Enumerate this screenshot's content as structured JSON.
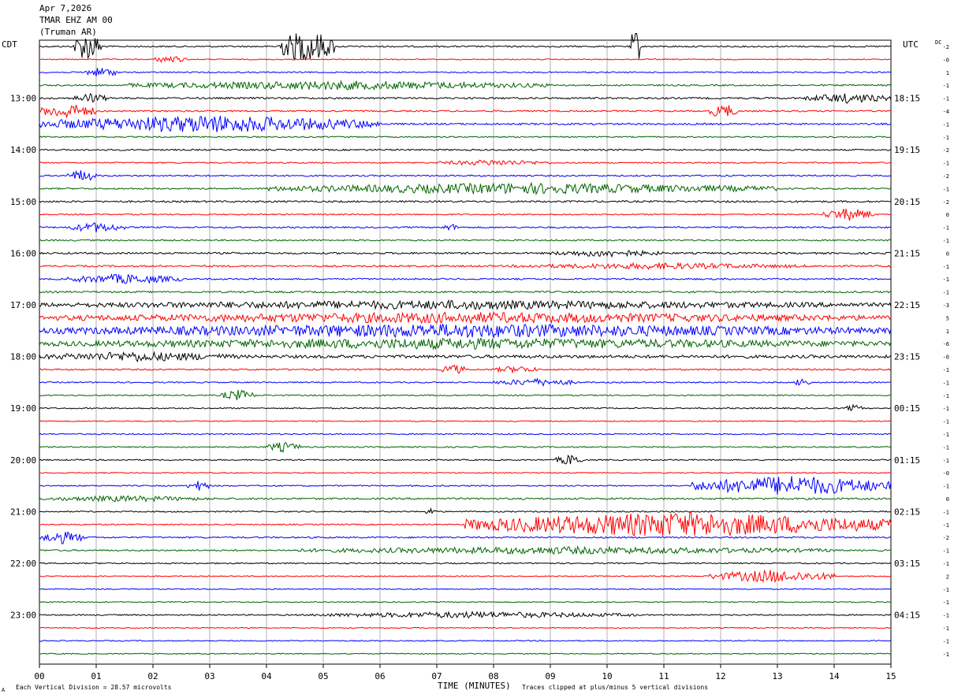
{
  "header": {
    "date": "Apr 7,2026",
    "station": "TMAR EHZ AM 00",
    "location": "(Truman AR)"
  },
  "left_zone_label": "CDT",
  "right_zone_label": "UTC",
  "dc_label": "DC",
  "footer": {
    "scale_note": "Each Vertical Division =  28.57 microvolts",
    "clip_note": "Traces clipped at plus/minus 5 vertical divisions",
    "corner_mark": "A"
  },
  "chart_data": {
    "type": "helicorder",
    "xlabel": "TIME (MINUTES)",
    "x_ticks": [
      "00",
      "01",
      "02",
      "03",
      "04",
      "05",
      "06",
      "07",
      "08",
      "09",
      "10",
      "11",
      "12",
      "13",
      "14",
      "15"
    ],
    "xlim": [
      0,
      15
    ],
    "trace_count": 48,
    "trace_minutes": 15,
    "trace_colors": [
      "#000000",
      "#ff0000",
      "#0000ff",
      "#006400"
    ],
    "left_hour_labels": [
      {
        "label": "13:00",
        "trace": 4
      },
      {
        "label": "14:00",
        "trace": 8
      },
      {
        "label": "15:00",
        "trace": 12
      },
      {
        "label": "16:00",
        "trace": 16
      },
      {
        "label": "17:00",
        "trace": 20
      },
      {
        "label": "18:00",
        "trace": 24
      },
      {
        "label": "19:00",
        "trace": 28
      },
      {
        "label": "20:00",
        "trace": 32
      },
      {
        "label": "21:00",
        "trace": 36
      },
      {
        "label": "22:00",
        "trace": 40
      },
      {
        "label": "23:00",
        "trace": 44
      }
    ],
    "right_hour_labels": [
      {
        "label": "18:15",
        "trace": 4
      },
      {
        "label": "19:15",
        "trace": 8
      },
      {
        "label": "20:15",
        "trace": 12
      },
      {
        "label": "21:15",
        "trace": 16
      },
      {
        "label": "22:15",
        "trace": 20
      },
      {
        "label": "23:15",
        "trace": 24
      },
      {
        "label": "00:15",
        "trace": 28
      },
      {
        "label": "01:15",
        "trace": 32
      },
      {
        "label": "02:15",
        "trace": 36
      },
      {
        "label": "03:15",
        "trace": 40
      },
      {
        "label": "04:15",
        "trace": 44
      }
    ],
    "dc_offsets": [
      "-2",
      "-0",
      "1",
      "-1",
      "-1",
      "-4",
      "-1",
      "-1",
      "-2",
      "-1",
      "-2",
      "-1",
      "-2",
      "0",
      "-1",
      "-1",
      "0",
      "-1",
      "-1",
      "-1",
      "-3",
      "5",
      "1",
      "-6",
      "-0",
      "-1",
      "-1",
      "-1",
      "-1",
      "-1",
      "-1",
      "-1",
      "-1",
      "-0",
      "-1",
      "0",
      "-1",
      "-1",
      "-2",
      "-1",
      "-1",
      "2",
      "-1",
      "-1",
      "-1",
      "-1",
      "-1",
      "-1"
    ],
    "trace_background_amplitude": [
      0.6,
      0.4,
      0.5,
      0.6,
      0.7,
      0.6,
      0.7,
      0.5,
      0.6,
      0.5,
      0.6,
      0.6,
      0.7,
      0.5,
      0.6,
      0.6,
      0.7,
      0.7,
      0.6,
      0.7,
      1.5,
      1.5,
      1.5,
      1.5,
      1.2,
      0.6,
      0.5,
      0.5,
      0.5,
      0.4,
      0.5,
      0.5,
      0.5,
      0.4,
      0.5,
      0.7,
      0.5,
      0.5,
      0.6,
      0.6,
      0.5,
      0.4,
      0.4,
      0.4,
      0.5,
      0.4,
      0.4,
      0.4
    ],
    "events": [
      {
        "trace": 0,
        "start_min": 0.6,
        "end_min": 1.1,
        "amplitude": 6
      },
      {
        "trace": 0,
        "start_min": 4.2,
        "end_min": 5.2,
        "amplitude": 7
      },
      {
        "trace": 0,
        "start_min": 10.4,
        "end_min": 10.6,
        "amplitude": 8
      },
      {
        "trace": 1,
        "start_min": 2.0,
        "end_min": 2.6,
        "amplitude": 1.5
      },
      {
        "trace": 2,
        "start_min": 0.8,
        "end_min": 1.4,
        "amplitude": 2
      },
      {
        "trace": 3,
        "start_min": 1.5,
        "end_min": 9.0,
        "amplitude": 1.8
      },
      {
        "trace": 4,
        "start_min": 0.6,
        "end_min": 1.2,
        "amplitude": 2
      },
      {
        "trace": 4,
        "start_min": 13.5,
        "end_min": 15.0,
        "amplitude": 2
      },
      {
        "trace": 5,
        "start_min": 0.0,
        "end_min": 1.0,
        "amplitude": 3
      },
      {
        "trace": 5,
        "start_min": 11.8,
        "end_min": 12.3,
        "amplitude": 3
      },
      {
        "trace": 6,
        "start_min": 0.0,
        "end_min": 6.0,
        "amplitude": 3.5
      },
      {
        "trace": 9,
        "start_min": 7.0,
        "end_min": 9.0,
        "amplitude": 1.2
      },
      {
        "trace": 10,
        "start_min": 0.5,
        "end_min": 1.0,
        "amplitude": 2.5
      },
      {
        "trace": 11,
        "start_min": 4.0,
        "end_min": 13.0,
        "amplitude": 2.2
      },
      {
        "trace": 13,
        "start_min": 13.8,
        "end_min": 14.7,
        "amplitude": 2.5
      },
      {
        "trace": 14,
        "start_min": 0.5,
        "end_min": 1.5,
        "amplitude": 2
      },
      {
        "trace": 14,
        "start_min": 7.1,
        "end_min": 7.4,
        "amplitude": 1.5
      },
      {
        "trace": 16,
        "start_min": 9.0,
        "end_min": 11.0,
        "amplitude": 1.5
      },
      {
        "trace": 17,
        "start_min": 8.3,
        "end_min": 13.5,
        "amplitude": 1.3
      },
      {
        "trace": 18,
        "start_min": 0.5,
        "end_min": 2.5,
        "amplitude": 2
      },
      {
        "trace": 20,
        "start_min": 0.0,
        "end_min": 15.0,
        "amplitude": 1.8
      },
      {
        "trace": 21,
        "start_min": 0.0,
        "end_min": 15.0,
        "amplitude": 2.2
      },
      {
        "trace": 22,
        "start_min": 0.0,
        "end_min": 15.0,
        "amplitude": 2.8
      },
      {
        "trace": 23,
        "start_min": 0.0,
        "end_min": 15.0,
        "amplitude": 2.2
      },
      {
        "trace": 24,
        "start_min": 0.0,
        "end_min": 3.5,
        "amplitude": 2
      },
      {
        "trace": 25,
        "start_min": 7.1,
        "end_min": 7.5,
        "amplitude": 2.2
      },
      {
        "trace": 25,
        "start_min": 8.0,
        "end_min": 8.8,
        "amplitude": 1.5
      },
      {
        "trace": 26,
        "start_min": 8.0,
        "end_min": 9.5,
        "amplitude": 1.5
      },
      {
        "trace": 26,
        "start_min": 13.3,
        "end_min": 13.6,
        "amplitude": 2
      },
      {
        "trace": 27,
        "start_min": 3.2,
        "end_min": 3.8,
        "amplitude": 2.2
      },
      {
        "trace": 28,
        "start_min": 14.2,
        "end_min": 14.5,
        "amplitude": 1.5
      },
      {
        "trace": 31,
        "start_min": 4.0,
        "end_min": 4.6,
        "amplitude": 2
      },
      {
        "trace": 32,
        "start_min": 9.1,
        "end_min": 9.6,
        "amplitude": 2.2
      },
      {
        "trace": 34,
        "start_min": 2.6,
        "end_min": 3.0,
        "amplitude": 2
      },
      {
        "trace": 34,
        "start_min": 11.5,
        "end_min": 15.0,
        "amplitude": 4
      },
      {
        "trace": 35,
        "start_min": 0.0,
        "end_min": 3.0,
        "amplitude": 1.2
      },
      {
        "trace": 36,
        "start_min": 6.8,
        "end_min": 7.0,
        "amplitude": 1.5
      },
      {
        "trace": 37,
        "start_min": 7.5,
        "end_min": 15.0,
        "amplitude": 5
      },
      {
        "trace": 38,
        "start_min": 0.0,
        "end_min": 0.8,
        "amplitude": 2.5
      },
      {
        "trace": 39,
        "start_min": 4.5,
        "end_min": 14.0,
        "amplitude": 1.5
      },
      {
        "trace": 41,
        "start_min": 11.8,
        "end_min": 14.0,
        "amplitude": 2.5
      },
      {
        "trace": 44,
        "start_min": 4.8,
        "end_min": 10.5,
        "amplitude": 1.3
      }
    ]
  }
}
